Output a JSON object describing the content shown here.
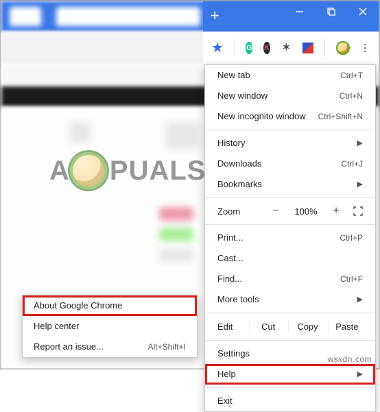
{
  "window": {
    "minimize": "—",
    "maximize": "▢",
    "close": "✕",
    "newtab": "+"
  },
  "toolbar": {
    "star": "★",
    "grammarly": "G",
    "ext_k": "K",
    "ext_bug": "✶",
    "menu_tip": "⋮"
  },
  "menu": {
    "new_tab": "New tab",
    "new_tab_sc": "Ctrl+T",
    "new_window": "New window",
    "new_window_sc": "Ctrl+N",
    "incognito": "New incognito window",
    "incognito_sc": "Ctrl+Shift+N",
    "history": "History",
    "downloads": "Downloads",
    "downloads_sc": "Ctrl+J",
    "bookmarks": "Bookmarks",
    "zoom_label": "Zoom",
    "zoom_minus": "−",
    "zoom_value": "100%",
    "zoom_plus": "+",
    "print": "Print...",
    "print_sc": "Ctrl+P",
    "cast": "Cast...",
    "find": "Find...",
    "find_sc": "Ctrl+F",
    "more_tools": "More tools",
    "edit_label": "Edit",
    "cut": "Cut",
    "copy": "Copy",
    "paste": "Paste",
    "settings": "Settings",
    "help": "Help",
    "exit": "Exit",
    "arrow": "▶"
  },
  "submenu": {
    "about": "About Google Chrome",
    "help_center": "Help center",
    "report": "Report an issue...",
    "report_sc": "Alt+Shift+I"
  },
  "watermark": {
    "left": "A",
    "right": "PUALS"
  },
  "footer": "wsxdn.com"
}
